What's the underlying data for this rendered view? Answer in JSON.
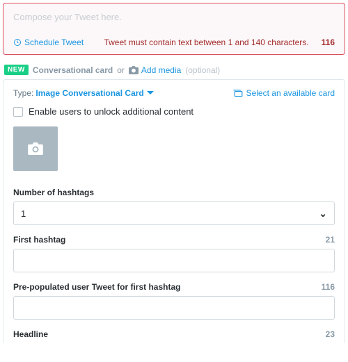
{
  "compose": {
    "placeholder": "Compose your Tweet here.",
    "schedule_label": "Schedule Tweet",
    "error": "Tweet must contain text between 1 and 140 characters.",
    "count": "116"
  },
  "header": {
    "new_badge": "NEW",
    "title": "Conversational card",
    "or": "or",
    "add_media": "Add media",
    "optional": "(optional)"
  },
  "card": {
    "type_prefix": "Type:",
    "type_value": "Image Conversational Card",
    "select_available": "Select an available card",
    "enable_label": "Enable users to unlock additional content",
    "fields": {
      "num_hashtags": {
        "label": "Number of hashtags",
        "value": "1"
      },
      "first_hashtag": {
        "label": "First hashtag",
        "count": "21",
        "value": ""
      },
      "pre_tweet": {
        "label": "Pre-populated user Tweet for first hashtag",
        "count": "116",
        "value": ""
      },
      "headline": {
        "label": "Headline",
        "count": "23"
      }
    }
  }
}
